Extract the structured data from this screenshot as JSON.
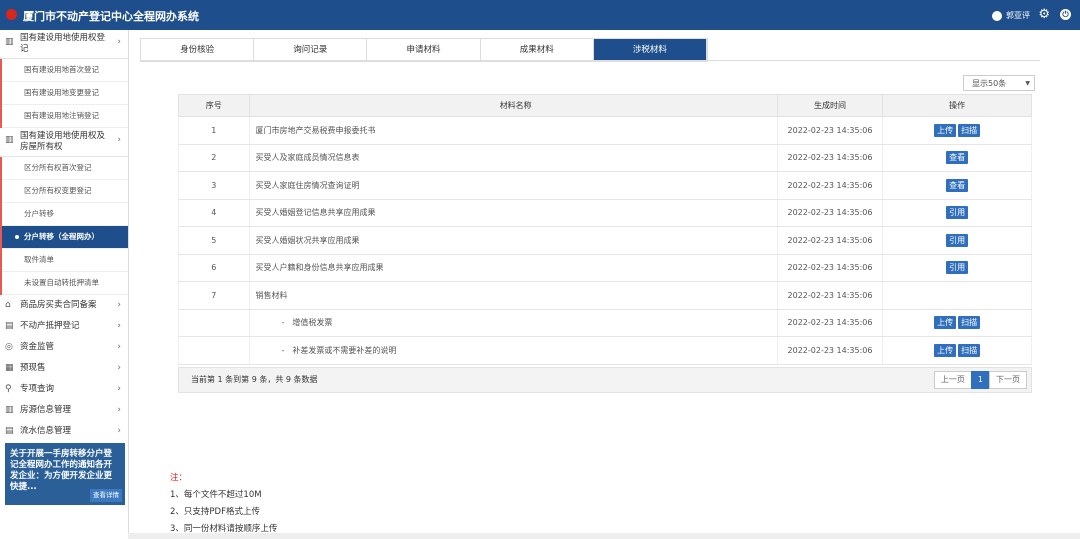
{
  "app": {
    "title": "厦门市不动产登记中心全程网办系统",
    "user": "郭亚评"
  },
  "sidebar": {
    "group1": {
      "label": "国有建设用地使用权登记",
      "subs": [
        "国有建设用地首次登记",
        "国有建设用地变更登记",
        "国有建设用地注销登记"
      ]
    },
    "group2": {
      "label": "国有建设用地使用权及房屋所有权",
      "subs": [
        "区分所有权首次登记",
        "区分所有权变更登记",
        "分户转移",
        "分户转移（全程网办）",
        "取件清单",
        "未设置自动转抵押清单"
      ]
    },
    "items": [
      {
        "label": "商品房买卖合同备案",
        "icon": "⌂"
      },
      {
        "label": "不动产抵押登记",
        "icon": "▤"
      },
      {
        "label": "资金监管",
        "icon": "◎"
      },
      {
        "label": "预现售",
        "icon": "▦"
      },
      {
        "label": "专项查询",
        "icon": "⚲"
      },
      {
        "label": "房源信息管理",
        "icon": "▥"
      },
      {
        "label": "流水信息管理",
        "icon": "▤"
      }
    ],
    "banner": {
      "text": "关于开展一手房转移分户登记全程网办工作的通知各开发企业：为方便开发企业更快捷...",
      "more": "查看详情"
    }
  },
  "tabs": [
    "身份核验",
    "询问记录",
    "申请材料",
    "成果材料",
    "涉税材料"
  ],
  "page_size": "显示50条",
  "table": {
    "headers": [
      "序号",
      "材料名称",
      "生成时间",
      "操作"
    ],
    "rows": [
      {
        "no": "1",
        "name": "厦门市房地产交易税费申报委托书",
        "time": "2022-02-23 14:35:06",
        "ops": [
          "上传",
          "扫描"
        ]
      },
      {
        "no": "2",
        "name": "买受人及家庭成员情况信息表",
        "time": "2022-02-23 14:35:06",
        "ops": [
          "查看"
        ]
      },
      {
        "no": "3",
        "name": "买受人家庭住房情况查询证明",
        "time": "2022-02-23 14:35:06",
        "ops": [
          "查看"
        ]
      },
      {
        "no": "4",
        "name": "买受人婚姻登记信息共享应用成果",
        "time": "2022-02-23 14:35:06",
        "ops": [
          "引用"
        ]
      },
      {
        "no": "5",
        "name": "买受人婚姻状况共享应用成果",
        "time": "2022-02-23 14:35:06",
        "ops": [
          "引用"
        ]
      },
      {
        "no": "6",
        "name": "买受人户籍和身份信息共享应用成果",
        "time": "2022-02-23 14:35:06",
        "ops": [
          "引用"
        ]
      },
      {
        "no": "7",
        "name": "销售材料",
        "time": "2022-02-23 14:35:06",
        "ops": []
      },
      {
        "no": "",
        "name": "-　增值税发票",
        "time": "2022-02-23 14:35:06",
        "ops": [
          "上传",
          "扫描"
        ],
        "sub": true
      },
      {
        "no": "",
        "name": "-　补差发票或不需要补差的说明",
        "time": "2022-02-23 14:35:06",
        "ops": [
          "上传",
          "扫描"
        ],
        "sub": true
      }
    ]
  },
  "footer": {
    "info": "当前第 1 条到第 9 条，共 9 条数据",
    "prev": "上一页",
    "page": "1",
    "next": "下一页"
  },
  "notes": {
    "title": "注：",
    "lines": [
      "1、每个文件不超过10M",
      "2、只支持PDF格式上传",
      "3、同一份材料请按顺序上传"
    ]
  }
}
